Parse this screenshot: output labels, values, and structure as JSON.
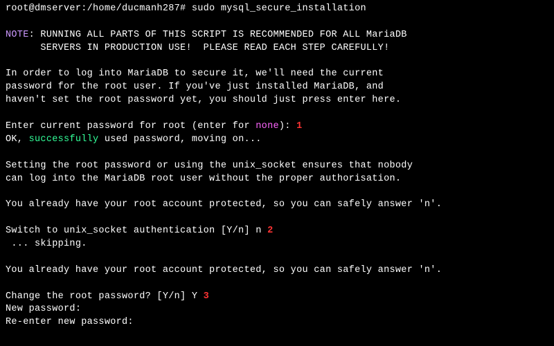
{
  "prompt": {
    "userhost": "root@dmserver",
    "path": ":/home/ducmanh287# ",
    "command": "sudo mysql_secure_installation"
  },
  "note": {
    "label": "NOTE",
    "line1": ": RUNNING ALL PARTS OF THIS SCRIPT IS RECOMMENDED FOR ALL MariaDB",
    "line2": "      SERVERS IN PRODUCTION USE!  PLEASE READ EACH STEP CAREFULLY!"
  },
  "intro": {
    "line1": "In order to log into MariaDB to secure it, we'll need the current",
    "line2": "password for the root user. If you've just installed MariaDB, and",
    "line3": "haven't set the root password yet, you should just press enter here."
  },
  "enter_pw": {
    "prefix": "Enter current password for root (enter for ",
    "none": "none",
    "suffix": "): ",
    "marker": "1"
  },
  "ok": {
    "prefix": "OK, ",
    "success": "successfully",
    "suffix": " used password, moving on..."
  },
  "setting": {
    "line1": "Setting the root password or using the unix_socket ensures that nobody",
    "line2": "can log into the MariaDB root user without the proper authorisation."
  },
  "already1": "You already have your root account protected, so you can safely answer 'n'.",
  "switch": {
    "text": "Switch to unix_socket authentication [Y/n] n ",
    "marker": "2"
  },
  "skipping": " ... skipping.",
  "already2": "You already have your root account protected, so you can safely answer 'n'.",
  "change": {
    "text": "Change the root password? [Y/n] Y ",
    "marker": "3"
  },
  "newpw": "New password:",
  "reenter": "Re-enter new password:"
}
